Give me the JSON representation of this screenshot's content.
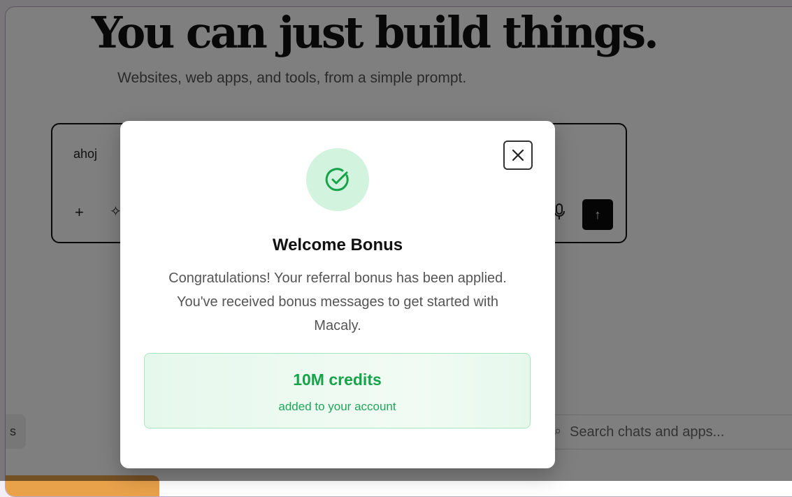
{
  "hero": {
    "title": "You can just build things.",
    "subtitle": "Websites, web apps, and tools, from a simple prompt."
  },
  "prompt": {
    "value": "ahoj",
    "add_label": "+",
    "sparkle_icon": "sparkle-icon",
    "mic_icon": "microphone-icon",
    "send_icon": "arrow-up-icon"
  },
  "background": {
    "left_tab_label": "s",
    "search_placeholder": "Search chats and apps..."
  },
  "modal": {
    "title": "Welcome Bonus",
    "body": "Congratulations! Your referral bonus has been applied. You've received bonus messages to get started with Macaly.",
    "credits_amount": "10M credits",
    "credits_note": "added to your account",
    "icon": "check-circle-icon",
    "close_icon": "close-icon"
  },
  "colors": {
    "accent_green": "#16a34a",
    "success_bg": "#d2f3dd",
    "overlay": "rgba(0,0,0,0.5)"
  }
}
